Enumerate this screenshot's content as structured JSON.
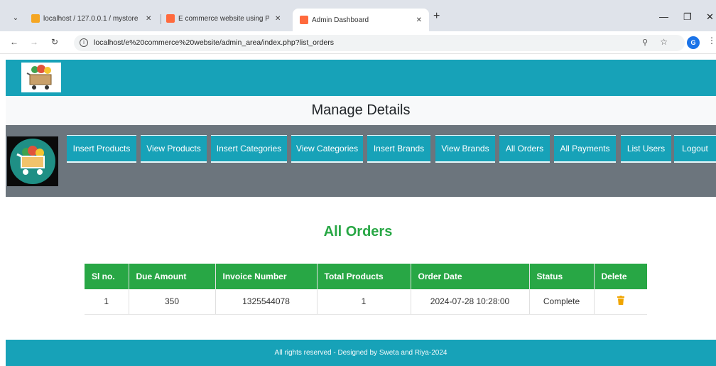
{
  "browser": {
    "tabs": [
      {
        "title": "localhost / 127.0.0.1 / mystore /",
        "active": false
      },
      {
        "title": "E commerce website using PHP",
        "active": false
      },
      {
        "title": "Admin Dashboard",
        "active": true
      }
    ],
    "url": "localhost/e%20commerce%20website/admin_area/index.php?list_orders",
    "profile_initial": "G"
  },
  "page": {
    "heading": "Manage Details",
    "nav": [
      "Insert Products",
      "View Products",
      "Insert Categories",
      "View Categories",
      "Insert Brands",
      "View Brands",
      "All Orders",
      "All Payments",
      "List Users",
      "Logout"
    ],
    "section_title": "All Orders",
    "table": {
      "headers": [
        "Sl no.",
        "Due Amount",
        "Invoice Number",
        "Total Products",
        "Order Date",
        "Status",
        "Delete"
      ],
      "rows": [
        [
          "1",
          "350",
          "1325544078",
          "1",
          "2024-07-28 10:28:00",
          "Complete"
        ]
      ]
    },
    "footer": "All rights reserved - Designed by Sweta and Riya-2024"
  },
  "colors": {
    "primary": "#17a2b8",
    "secondary": "#6c757d",
    "success": "#28a745",
    "delete_icon": "#f0a500"
  }
}
